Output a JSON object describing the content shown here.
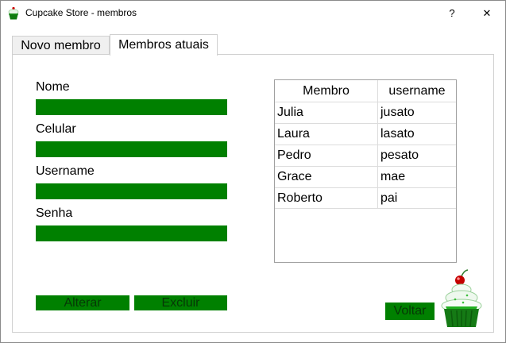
{
  "window": {
    "title": "Cupcake Store - membros",
    "help_label": "?",
    "close_label": "✕"
  },
  "tabs": [
    {
      "label": "Novo membro"
    },
    {
      "label": "Membros atuais"
    }
  ],
  "form": {
    "nome_label": "Nome",
    "celular_label": "Celular",
    "username_label": "Username",
    "senha_label": "Senha",
    "nome_value": "",
    "celular_value": "",
    "username_value": "",
    "senha_value": ""
  },
  "buttons": {
    "alterar": "Alterar",
    "excluir": "Excluir",
    "voltar": "Voltar"
  },
  "table": {
    "columns": [
      "Membro",
      "username"
    ],
    "rows": [
      [
        "Julia",
        "jusato"
      ],
      [
        "Laura",
        "lasato"
      ],
      [
        "Pedro",
        "pesato"
      ],
      [
        "Grace",
        "mae"
      ],
      [
        "Roberto",
        "pai"
      ]
    ]
  },
  "colors": {
    "accent_green": "#008000"
  },
  "icons": {
    "app": "cupcake-icon",
    "logo": "cupcake-logo"
  }
}
